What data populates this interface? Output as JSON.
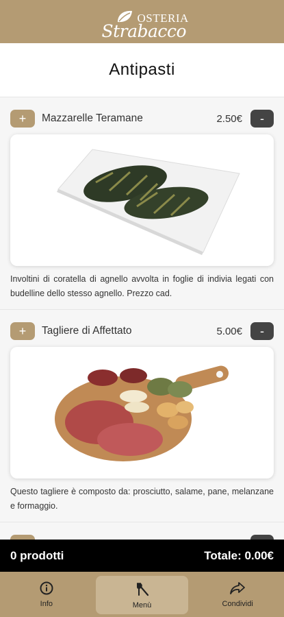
{
  "header": {
    "logo_top": "OSTERIA",
    "logo_bottom": "Strabacco"
  },
  "page": {
    "title": "Antipasti"
  },
  "items": [
    {
      "add_label": "+",
      "name": "Mazzarelle Teramane",
      "price": "2.50€",
      "remove_label": "-",
      "description": "Involtini di coratella di agnello avvolta in foglie di indivia legati con budelline dello stesso agnello. Prezzo cad."
    },
    {
      "add_label": "+",
      "name": "Tagliere di Affettato",
      "price": "5.00€",
      "remove_label": "-",
      "description": "Questo tagliere è composto da: prosciutto, salame, pane, melanzane e formaggio."
    }
  ],
  "cart": {
    "count_label": "0 prodotti",
    "total_label": "Totale: 0.00€"
  },
  "tabs": [
    {
      "label": "Info",
      "icon": "info-icon"
    },
    {
      "label": "Menù",
      "icon": "cutlery-icon"
    },
    {
      "label": "Condividi",
      "icon": "share-icon"
    }
  ],
  "colors": {
    "brand": "#b49b73",
    "brand_light": "#c9b593",
    "dark_button": "#444444",
    "cart_bar": "#000000"
  }
}
